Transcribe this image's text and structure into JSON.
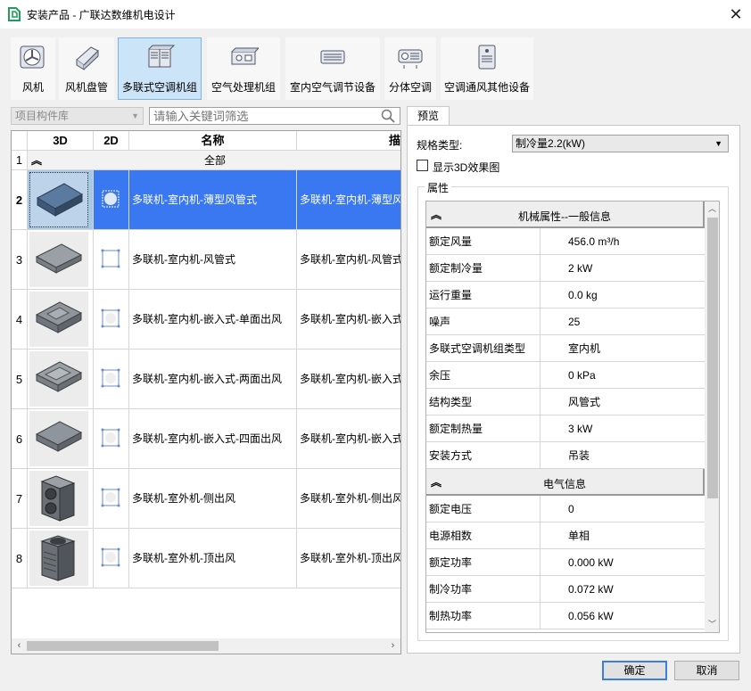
{
  "window": {
    "title": "安装产品 - 广联达数维机电设计",
    "close_label": "✕"
  },
  "toolbar": {
    "items": [
      {
        "label": "风机",
        "icon": "fan-icon"
      },
      {
        "label": "风机盘管",
        "icon": "fan-coil-icon"
      },
      {
        "label": "多联式空调机组",
        "icon": "vrf-unit-icon",
        "active": true
      },
      {
        "label": "空气处理机组",
        "icon": "air-handler-icon"
      },
      {
        "label": "室内空气调节设备",
        "icon": "indoor-ac-icon"
      },
      {
        "label": "分体空调",
        "icon": "split-ac-icon"
      },
      {
        "label": "空调通风其他设备",
        "icon": "hvac-other-icon"
      }
    ]
  },
  "filter": {
    "library_value": "项目构件库",
    "search_placeholder": "请输入关键词筛选"
  },
  "grid": {
    "columns": [
      "3D",
      "2D",
      "名称",
      "描述"
    ],
    "group_row": {
      "num": "1",
      "label": "全部"
    },
    "rows": [
      {
        "num": "2",
        "name": "多联机-室内机-薄型风管式",
        "desc": "多联机-室内机-薄型风管式",
        "selected": true
      },
      {
        "num": "3",
        "name": "多联机-室内机-风管式",
        "desc": "多联机-室内机-风管式"
      },
      {
        "num": "4",
        "name": "多联机-室内机-嵌入式-单面出风",
        "desc": "多联机-室内机-嵌入式-单面出风"
      },
      {
        "num": "5",
        "name": "多联机-室内机-嵌入式-两面出风",
        "desc": "多联机-室内机-嵌入式-两面出风"
      },
      {
        "num": "6",
        "name": "多联机-室内机-嵌入式-四面出风",
        "desc": "多联机-室内机-嵌入式-四面出风"
      },
      {
        "num": "7",
        "name": "多联机-室外机-侧出风",
        "desc": "多联机-室外机-侧出风"
      },
      {
        "num": "8",
        "name": "多联机-室外机-顶出风",
        "desc": "多联机-室外机-顶出风"
      }
    ]
  },
  "preview": {
    "tab_label": "预览",
    "spec_label": "规格类型:",
    "spec_value": "制冷量2.2(kW)",
    "show3d_label": "显示3D效果图",
    "attributes_legend": "属性",
    "categories": [
      {
        "label": "机械属性--一般信息",
        "props": [
          {
            "name": "额定风量",
            "value": "456.0 m³/h"
          },
          {
            "name": "额定制冷量",
            "value": "2 kW"
          },
          {
            "name": "运行重量",
            "value": "0.0 kg"
          },
          {
            "name": "噪声",
            "value": "25"
          },
          {
            "name": "多联式空调机组类型",
            "value": "室内机"
          },
          {
            "name": "余压",
            "value": "0 kPa"
          },
          {
            "name": "结构类型",
            "value": "风管式"
          },
          {
            "name": "额定制热量",
            "value": "3 kW"
          },
          {
            "name": "安装方式",
            "value": "吊装"
          }
        ]
      },
      {
        "label": "电气信息",
        "props": [
          {
            "name": "额定电压",
            "value": "0"
          },
          {
            "name": "电源相数",
            "value": "单相"
          },
          {
            "name": "额定功率",
            "value": "0.000 kW"
          },
          {
            "name": "制冷功率",
            "value": "0.072 kW"
          },
          {
            "name": "制热功率",
            "value": "0.056 kW"
          }
        ]
      }
    ]
  },
  "buttons": {
    "ok": "确定",
    "cancel": "取消"
  },
  "colors": {
    "selection": "#3a78f2",
    "active_toolbar": "#cce4f7"
  }
}
